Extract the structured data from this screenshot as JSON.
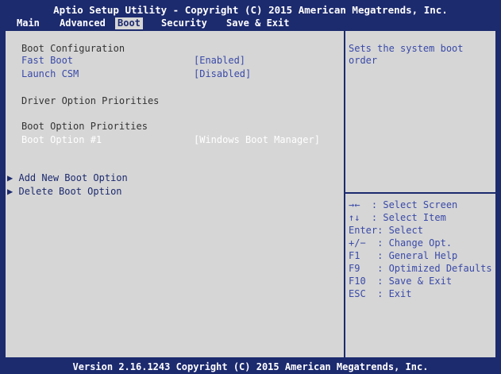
{
  "header": {
    "title": "Aptio Setup Utility - Copyright (C) 2015 American Megatrends, Inc."
  },
  "tabs": [
    {
      "label": "Main"
    },
    {
      "label": "Advanced"
    },
    {
      "label": "Boot",
      "active": true
    },
    {
      "label": "Security"
    },
    {
      "label": "Save & Exit"
    }
  ],
  "settings": {
    "boot_configuration": "Boot Configuration",
    "fast_boot": {
      "label": "Fast Boot",
      "value": "[Enabled]"
    },
    "launch_csm": {
      "label": "Launch CSM",
      "value": "[Disabled]"
    },
    "driver_option_priorities": "Driver Option Priorities",
    "boot_option_priorities": "Boot Option Priorities",
    "boot_option_1": {
      "label": "Boot Option #1",
      "value": "[Windows Boot Manager]"
    },
    "add_new_boot_option": "Add New Boot Option",
    "delete_boot_option": "Delete Boot Option",
    "submenu_arrow": "▶"
  },
  "help": {
    "description": [
      "Sets the system boot",
      "order"
    ],
    "keys": [
      "→←  : Select Screen",
      "↑↓  : Select Item",
      "Enter: Select",
      "+/−  : Change Opt.",
      "F1   : General Help",
      "F9   : Optimized Defaults",
      "F10  : Save & Exit",
      "ESC  : Exit"
    ]
  },
  "footer": {
    "version": "Version 2.16.1243 Copyright (C) 2015 American Megatrends, Inc."
  },
  "colors": {
    "background": "#1c2a6e",
    "panel": "#d6d6d6",
    "link": "#3a4aa8",
    "selected": "#ffffff"
  }
}
